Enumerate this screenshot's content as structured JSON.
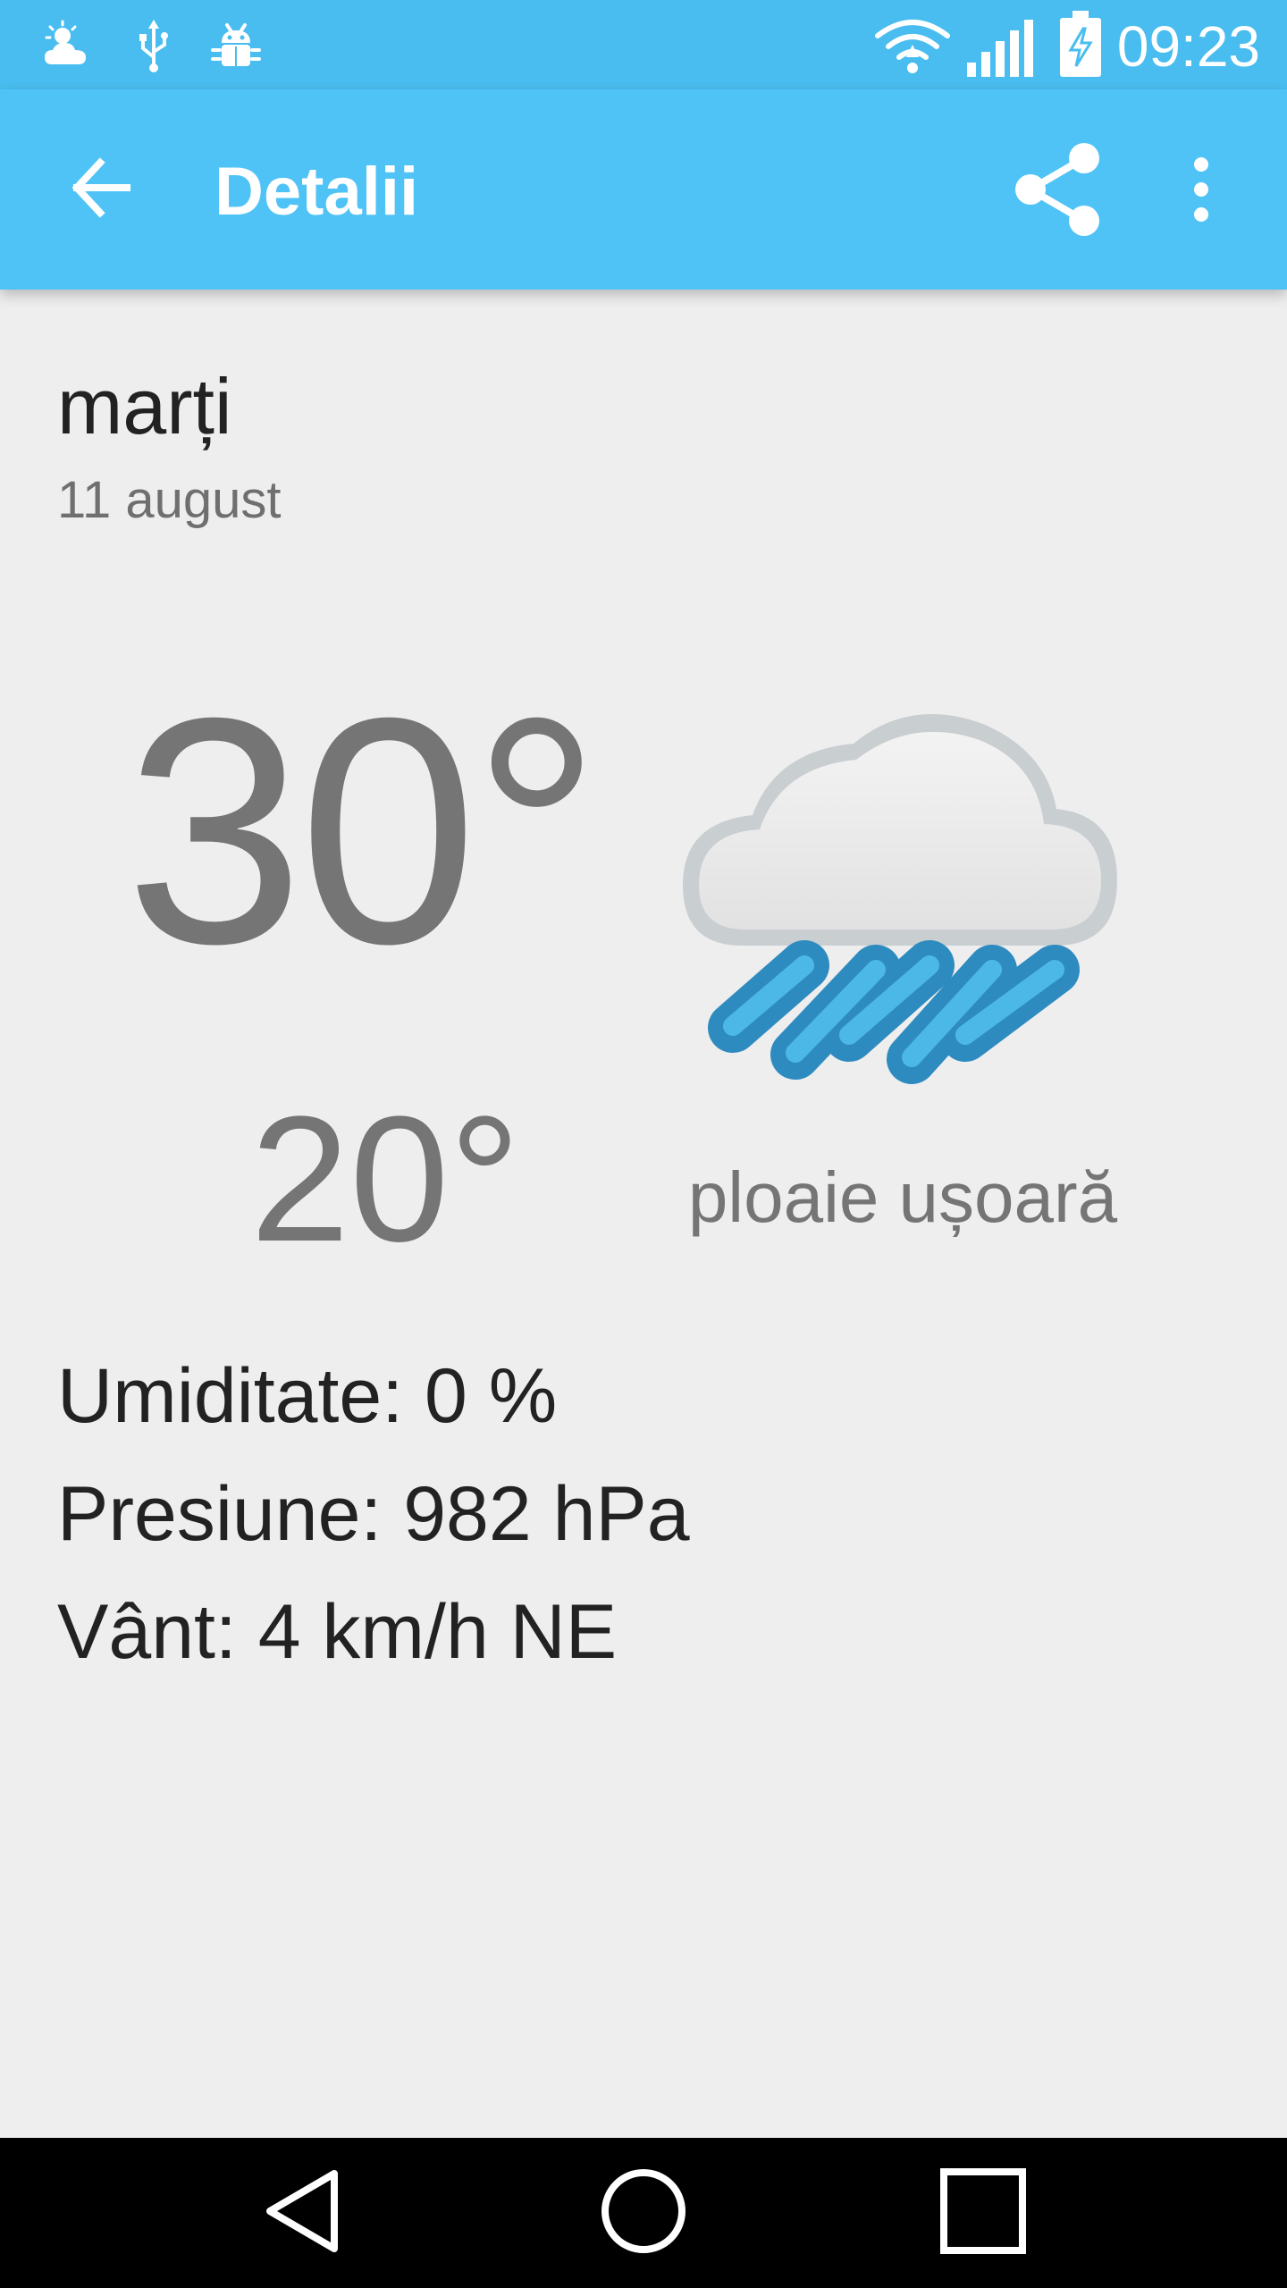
{
  "status_bar": {
    "time": "09:23",
    "left_icons": [
      "weather-notification-icon",
      "usb-icon",
      "android-debug-icon"
    ],
    "right_icons": [
      "wifi-icon",
      "signal-icon",
      "battery-charging-icon"
    ]
  },
  "app_bar": {
    "title": "Detalii",
    "back_icon": "arrow-back-icon",
    "share_icon": "share-icon",
    "overflow_icon": "more-vert-icon"
  },
  "forecast": {
    "day_name": "marți",
    "date": "11 august",
    "high_temp": "30°",
    "low_temp": "20°",
    "condition_icon": "light-rain-icon",
    "condition": "ploaie ușoară"
  },
  "details": {
    "humidity": "Umiditate: 0 %",
    "pressure": "Presiune: 982 hPa",
    "wind": "Vânt: 4 km/h NE"
  },
  "nav_bar": {
    "icons": [
      "nav-back-icon",
      "nav-home-icon",
      "nav-recents-icon"
    ]
  },
  "colors": {
    "status_bar": "#49bdef",
    "app_bar": "#4fc3f6",
    "background": "#eeeeee",
    "rain": "#2e8bc0",
    "rain_light": "#4cb8e8"
  }
}
